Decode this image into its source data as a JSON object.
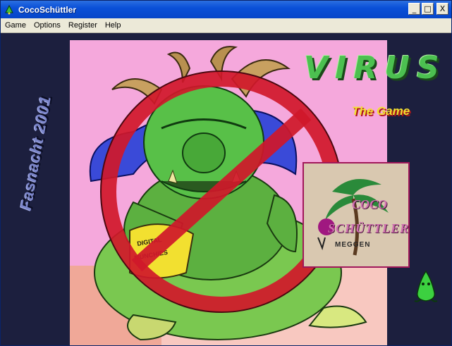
{
  "window": {
    "title": "CocoSchüttler",
    "buttons": {
      "minimize": "_",
      "maximize": "□",
      "close": "X"
    }
  },
  "menu": {
    "items": [
      {
        "label": "Game"
      },
      {
        "label": "Options"
      },
      {
        "label": "Register"
      },
      {
        "label": "Help"
      }
    ]
  },
  "content": {
    "side_text": "Fasnacht 2001",
    "game_title": "VIRUS",
    "game_subtitle": "The Game",
    "sign_text_1": "DIGITAL",
    "sign_text_2": "MUNCHIES",
    "logo": {
      "line1": "COCO",
      "line2": "SCHÜTTLER",
      "line3": "MEGGEN"
    }
  },
  "colors": {
    "titlebar": "#0a50d8",
    "menubar": "#ece9d8",
    "background": "#1c1f3e",
    "cover_pink": "#f5a8dc",
    "monster_green": "#5cc04a",
    "prohibition_red": "#d0182a",
    "hair_blue": "#3a4ad8",
    "virus_green": "#4cc050",
    "subtitle_yellow": "#f2e030"
  },
  "icons": [
    "app-icon",
    "minimize-icon",
    "maximize-icon",
    "close-icon",
    "mascot-icon"
  ]
}
